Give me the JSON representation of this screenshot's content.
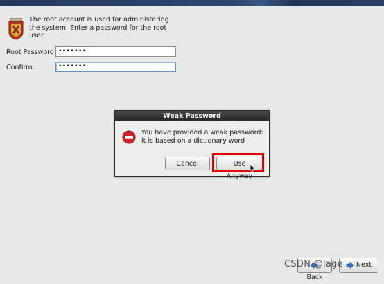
{
  "intro": {
    "text": "The root account is used for administering the system.  Enter a password for the root user."
  },
  "form": {
    "root_password_label": "Root Password:",
    "root_password_value": "•••••••",
    "confirm_label": "Confirm:",
    "confirm_value": "•••••••"
  },
  "dialog": {
    "title": "Weak Password",
    "message": "You have provided a weak password: it is based on a dictionary word",
    "cancel_label": "Cancel",
    "use_anyway_label": "Use Anyway",
    "icon": "error-icon"
  },
  "navigation": {
    "back_label": "Back",
    "next_label": "Next"
  },
  "watermark": "CSDN @lage",
  "colors": {
    "banner": "#2f4570",
    "dialog_title_bg": "#2a2a2a",
    "highlight": "#e00000",
    "error_icon": "#d0202a"
  }
}
